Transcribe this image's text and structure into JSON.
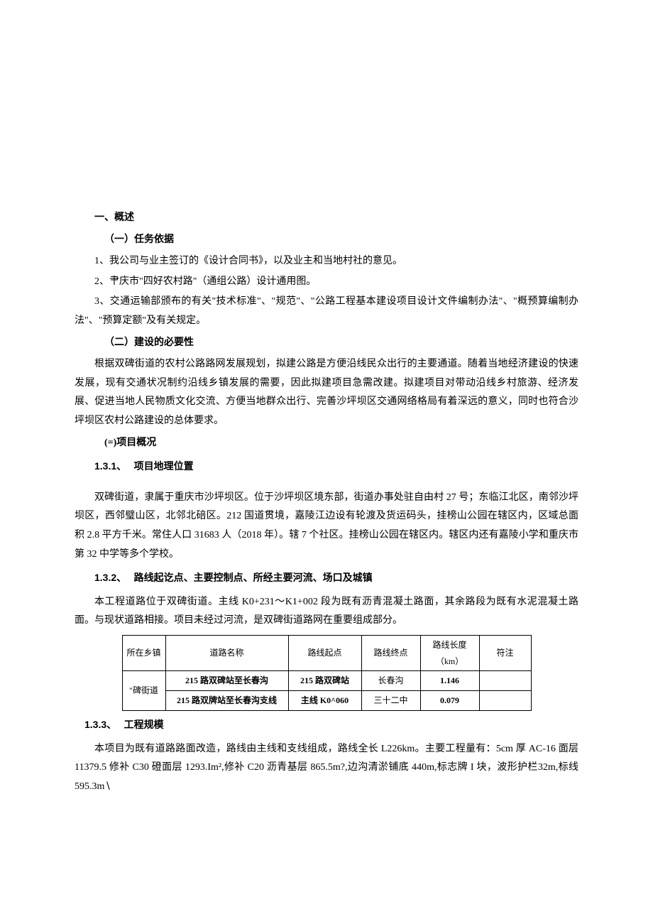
{
  "section1": {
    "title": "一、概述",
    "sub1": {
      "title": "（一）任务依据",
      "items": [
        "1、我公司与业主签订的《设计合同书》，以及业主和当地村社的意见。",
        "2、肀庆市\"四好农村路\"（通组公路）设计通用图。",
        "3、交通运输部颁布的有关\"技术标准\"、\"规范\"、\"公路工程基本建设项目设计文件编制办法\"、\"概预算编制办法\"、\"预算定额\"及有关规定。"
      ]
    },
    "sub2": {
      "title": "（二）建设的必要性",
      "body": "根据双碑街道的农村公路路网发展规划，拟建公路是方便沿线民众出行的主要通道。随着当地经济建设的快速发展，现有交通状况制约沿线乡镇发展的需要，因此拟建项目急需改建。拟建项目对带动沿线乡村旅游、经济发展、促进当地人民物质文化交流、方便当地群众出行、完善沙坪坝区交通网络格局有着深远的意义，同时也符合沙坪坝区农村公路建设的总体要求。"
    },
    "sub3": {
      "title": "(=)项目概况",
      "s131": {
        "num": "1.3.1、",
        "title": "项目地理位置",
        "body": "双碑街道，隶属于重庆市沙坪坝区。位于沙坪坝区境东部，街道办事处驻自由村 27 号；东临江北区，南邻沙坪坝区，西邻璧山区，北邻北碚区。212 国道贯境，嘉陵江边设有轮渡及货运码头，挂榜山公园在辖区内，区域总面积 2.8 平方千米。常住人口 31683 人（2018 年）。辖 7 个社区。挂榜山公园在辖区内。辖区内还有嘉陵小学和重庆市第 32 中学等多个学校。"
      },
      "s132": {
        "num": "1.3.2、",
        "title": "路线起讫点、主要控制点、所经主要河流、场口及城镇",
        "body": "本工程道路位于双碑街道。主线 K0+231～K1+002 段为既有沥青混凝土路面，其余路段为既有水泥混凝土路面。与现状道路相接。项目未经过河流，是双碑街道路网在重要组成部分。"
      },
      "s133": {
        "num": "1.3.3、",
        "title": "工程规模",
        "body": "本项目为既有道路路面改造，路线由主线和支线组成，路线全长 L226km。主要工程量有：5cm 厚 AC-16 面层 11379.5 修补 C30 磴面层 1293.Im²,修补 C20 沥青基层 865.5m?,边沟清淤铺底 440m,标志牌 I 块，波形护栏32m,标线 595.3m∖"
      }
    }
  },
  "table": {
    "headers": {
      "c0": "所在乡镇",
      "c1": "道路名称",
      "c2": "路线起点",
      "c3": "路线终点",
      "c4": "路线长度（km）",
      "c5": "符注"
    },
    "town": "\"碑街道",
    "rows": [
      {
        "name": "215 路双碑站至长春沟",
        "start": "215 路双碑站",
        "end": "长春沟",
        "len": "1.146",
        "note": ""
      },
      {
        "name": "215 路双牌站至长春沟支线",
        "start": "主线 K0^060",
        "end": "三十二中",
        "len": "0.079",
        "note": ""
      }
    ]
  }
}
